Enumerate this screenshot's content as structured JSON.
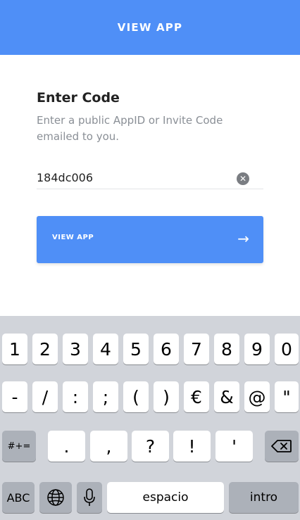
{
  "header": {
    "title": "VIEW APP"
  },
  "form": {
    "title": "Enter Code",
    "description": "Enter a public AppID or Invite Code emailed to you.",
    "code_value": "184dc006",
    "clear_icon": "clear-icon",
    "button_label": "VIEW APP",
    "button_icon": "arrow-right-icon"
  },
  "keyboard": {
    "row1": [
      "1",
      "2",
      "3",
      "4",
      "5",
      "6",
      "7",
      "8",
      "9",
      "0"
    ],
    "row2": [
      "-",
      "/",
      ":",
      ";",
      "(",
      ")",
      "€",
      "&",
      "@",
      "\""
    ],
    "row3": {
      "symbols_toggle": "#+=",
      "keys": [
        ".",
        ",",
        "?",
        "!",
        "'"
      ],
      "backspace_icon": "backspace-icon"
    },
    "row4": {
      "abc": "ABC",
      "globe_icon": "globe-icon",
      "mic_icon": "microphone-icon",
      "space": "espacio",
      "return": "intro"
    }
  },
  "colors": {
    "accent": "#4f8ff7",
    "keyboard_bg": "#d1d4da",
    "key_dark": "#acb1b9"
  }
}
